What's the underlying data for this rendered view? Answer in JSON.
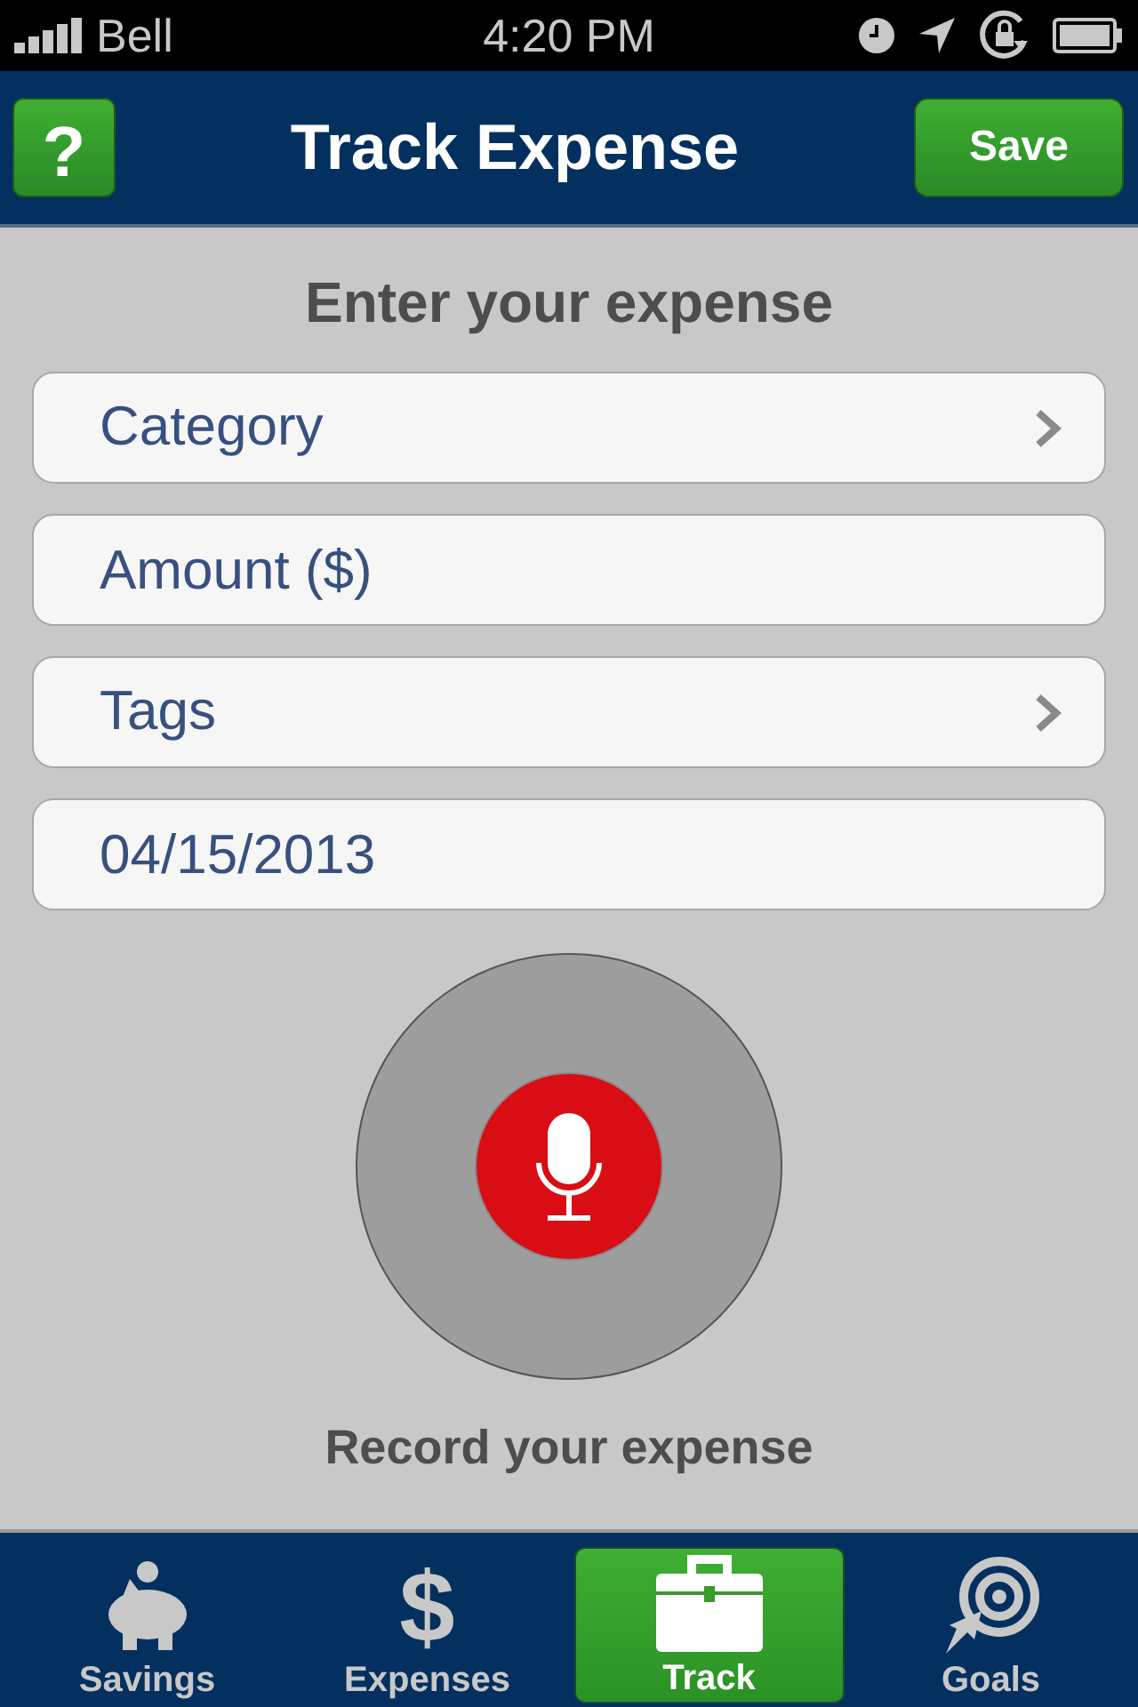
{
  "status_bar": {
    "carrier": "Bell",
    "time": "4:20 PM"
  },
  "nav": {
    "help": "?",
    "title": "Track Expense",
    "save": "Save"
  },
  "heading": "Enter your expense",
  "fields": [
    {
      "kind": "select",
      "label": "Category"
    },
    {
      "kind": "input",
      "placeholder": "Amount ($)"
    },
    {
      "kind": "select",
      "label": "Tags"
    },
    {
      "kind": "input",
      "value": "04/15/2013"
    }
  ],
  "record": {
    "label": "Record your expense"
  },
  "tabs": [
    {
      "kind": "piggy",
      "label": "Savings",
      "selected": false
    },
    {
      "kind": "dollar",
      "glyph": "$",
      "label": "Expenses",
      "selected": false
    },
    {
      "kind": "case",
      "label": "Track",
      "selected": true
    },
    {
      "kind": "target",
      "label": "Goals",
      "selected": false
    }
  ]
}
